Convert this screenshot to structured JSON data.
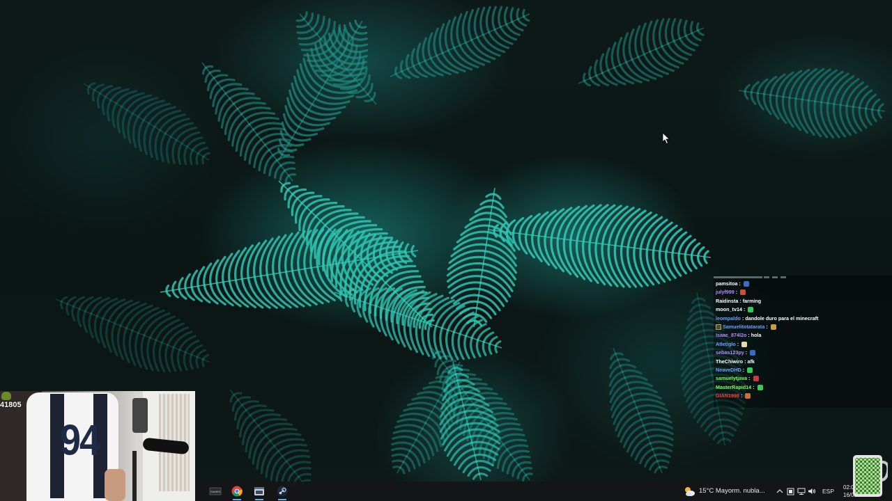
{
  "stream": {
    "viewer_count": "41805"
  },
  "chat": {
    "messages": [
      {
        "user": "pamsitoa",
        "text": "",
        "user_color": "#ffffff",
        "emote_color": "#3b6ac8"
      },
      {
        "user": "julyf999",
        "text": "",
        "user_color": "#b58cff",
        "emote_color": "#c8503b"
      },
      {
        "user": "Raidinsta",
        "text": "farming",
        "user_color": "#ffffff",
        "emote_color": ""
      },
      {
        "user": "moon_tv14",
        "text": "",
        "user_color": "#ffffff",
        "emote_color": "#3bc85a"
      },
      {
        "user": "leompaldo",
        "text": "dandole duro para el minecraft",
        "user_color": "#6aa0ff",
        "emote_color": ""
      },
      {
        "user": "Samuelitotatarata",
        "text": "",
        "user_color": "#6aa0ff",
        "emote_color": "#c8a03b"
      },
      {
        "user": "Isaac_874l2o",
        "text": "hola",
        "user_color": "#b58cff",
        "emote_color": ""
      },
      {
        "user": "Atletiglo",
        "text": "",
        "user_color": "#6aa0ff",
        "emote_color": "#e8d8b0"
      },
      {
        "user": "sebas123py",
        "text": "",
        "user_color": "#b58cff",
        "emote_color": "#3b6ac8"
      },
      {
        "user": "TheChiwiro",
        "text": "afk",
        "user_color": "#ffffff",
        "emote_color": ""
      },
      {
        "user": "NeaveDHD",
        "text": "",
        "user_color": "#6aa0ff",
        "emote_color": "#3bc85a"
      },
      {
        "user": "samuelytjava",
        "text": "",
        "user_color": "#7cff5a",
        "emote_color": "#c83b3b"
      },
      {
        "user": "MasterRapid14",
        "text": "",
        "user_color": "#7cff5a",
        "emote_color": "#3bc85a"
      },
      {
        "user": "GIAN1998",
        "text": "",
        "user_color": "#ff4040",
        "emote_color": "#c8703b"
      }
    ]
  },
  "taskbar": {
    "apps": [
      {
        "name": "game-app",
        "label": "GAMES"
      },
      {
        "name": "chrome"
      },
      {
        "name": "file-manager"
      },
      {
        "name": "steam"
      }
    ],
    "weather": {
      "text": "15°C  Mayorm. nubla...",
      "icon": "partly-cloudy-icon"
    },
    "language": "ESP",
    "clock": {
      "time": "02:01",
      "date": "16/01/"
    }
  },
  "colors": {
    "taskbar_bg": "#141618",
    "accent": "#5ab0e8"
  }
}
